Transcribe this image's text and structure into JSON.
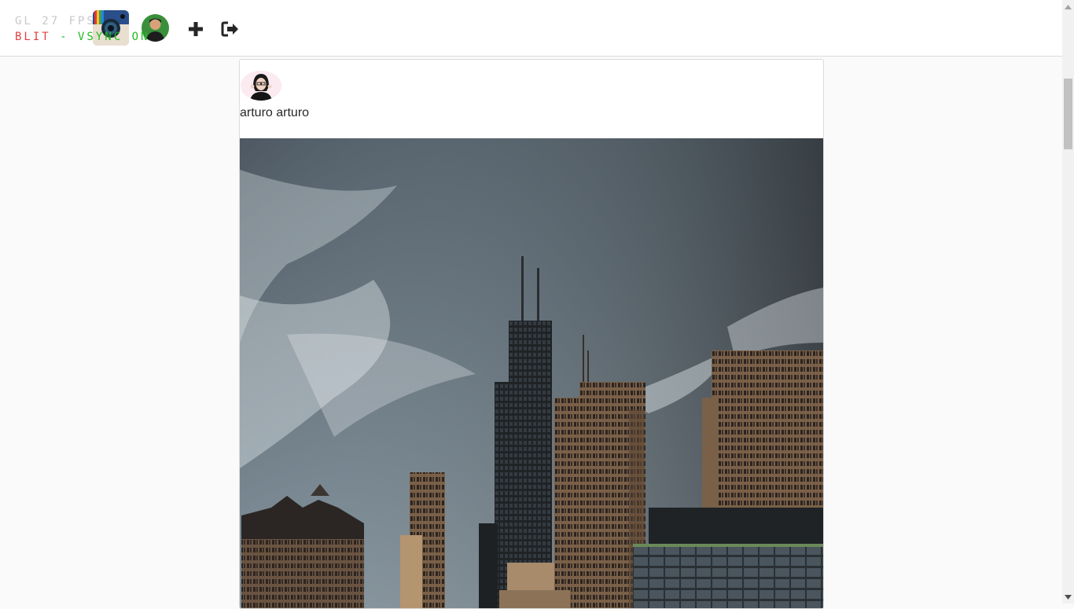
{
  "debug_overlay": {
    "fps_line": "GL 27 FPS",
    "blit_label": "BLIT",
    "vsync_label": " - VSYNC ON"
  },
  "nav": {
    "logo_icon": "instagram-camera-logo",
    "profile_icon": "user-avatar",
    "add_icon": "plus-icon",
    "logout_icon": "sign-out-icon"
  },
  "post": {
    "username": "arturo arturo",
    "avatar_icon": "user-avatar",
    "image_subject": "city-skyline-photo"
  },
  "colors": {
    "accent_text": "#262626",
    "border": "#dbdbdb",
    "background": "#fafafa"
  }
}
